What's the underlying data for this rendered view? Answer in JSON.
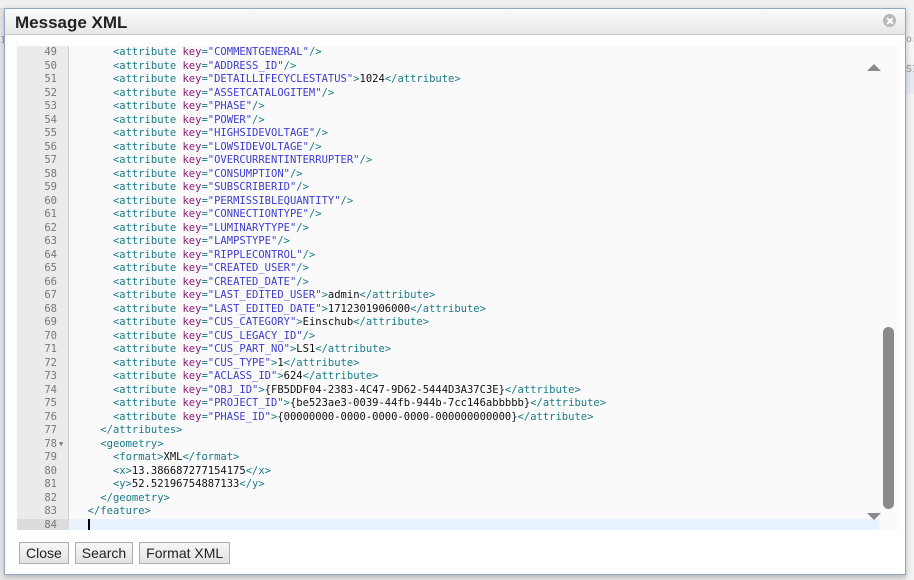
{
  "dialog": {
    "title": "Message XML",
    "close_icon": "close-circle-icon"
  },
  "background": {
    "left_fragment": "1",
    "right_fragment_1": "or",
    "right_fragment_2": "SIS"
  },
  "editor": {
    "lines": [
      {
        "n": "49",
        "indent": 6,
        "tokens": [
          [
            "tag",
            "<attribute "
          ],
          [
            "attr",
            "key"
          ],
          [
            "tag",
            "="
          ],
          [
            "str",
            "\"COMMENTGENERAL\""
          ],
          [
            "tag",
            "/>"
          ]
        ]
      },
      {
        "n": "50",
        "indent": 6,
        "tokens": [
          [
            "tag",
            "<attribute "
          ],
          [
            "attr",
            "key"
          ],
          [
            "tag",
            "="
          ],
          [
            "str",
            "\"ADDRESS_ID\""
          ],
          [
            "tag",
            "/>"
          ]
        ]
      },
      {
        "n": "51",
        "indent": 6,
        "tokens": [
          [
            "tag",
            "<attribute "
          ],
          [
            "attr",
            "key"
          ],
          [
            "tag",
            "="
          ],
          [
            "str",
            "\"DETAILLIFECYCLESTATUS\""
          ],
          [
            "tag",
            ">"
          ],
          [
            "text",
            "1024"
          ],
          [
            "tag",
            "</attribute>"
          ]
        ]
      },
      {
        "n": "52",
        "indent": 6,
        "tokens": [
          [
            "tag",
            "<attribute "
          ],
          [
            "attr",
            "key"
          ],
          [
            "tag",
            "="
          ],
          [
            "str",
            "\"ASSETCATALOGITEM\""
          ],
          [
            "tag",
            "/>"
          ]
        ]
      },
      {
        "n": "53",
        "indent": 6,
        "tokens": [
          [
            "tag",
            "<attribute "
          ],
          [
            "attr",
            "key"
          ],
          [
            "tag",
            "="
          ],
          [
            "str",
            "\"PHASE\""
          ],
          [
            "tag",
            "/>"
          ]
        ]
      },
      {
        "n": "54",
        "indent": 6,
        "tokens": [
          [
            "tag",
            "<attribute "
          ],
          [
            "attr",
            "key"
          ],
          [
            "tag",
            "="
          ],
          [
            "str",
            "\"POWER\""
          ],
          [
            "tag",
            "/>"
          ]
        ]
      },
      {
        "n": "55",
        "indent": 6,
        "tokens": [
          [
            "tag",
            "<attribute "
          ],
          [
            "attr",
            "key"
          ],
          [
            "tag",
            "="
          ],
          [
            "str",
            "\"HIGHSIDEVOLTAGE\""
          ],
          [
            "tag",
            "/>"
          ]
        ]
      },
      {
        "n": "56",
        "indent": 6,
        "tokens": [
          [
            "tag",
            "<attribute "
          ],
          [
            "attr",
            "key"
          ],
          [
            "tag",
            "="
          ],
          [
            "str",
            "\"LOWSIDEVOLTAGE\""
          ],
          [
            "tag",
            "/>"
          ]
        ]
      },
      {
        "n": "57",
        "indent": 6,
        "tokens": [
          [
            "tag",
            "<attribute "
          ],
          [
            "attr",
            "key"
          ],
          [
            "tag",
            "="
          ],
          [
            "str",
            "\"OVERCURRENTINTERRUPTER\""
          ],
          [
            "tag",
            "/>"
          ]
        ]
      },
      {
        "n": "58",
        "indent": 6,
        "tokens": [
          [
            "tag",
            "<attribute "
          ],
          [
            "attr",
            "key"
          ],
          [
            "tag",
            "="
          ],
          [
            "str",
            "\"CONSUMPTION\""
          ],
          [
            "tag",
            "/>"
          ]
        ]
      },
      {
        "n": "59",
        "indent": 6,
        "tokens": [
          [
            "tag",
            "<attribute "
          ],
          [
            "attr",
            "key"
          ],
          [
            "tag",
            "="
          ],
          [
            "str",
            "\"SUBSCRIBERID\""
          ],
          [
            "tag",
            "/>"
          ]
        ]
      },
      {
        "n": "60",
        "indent": 6,
        "tokens": [
          [
            "tag",
            "<attribute "
          ],
          [
            "attr",
            "key"
          ],
          [
            "tag",
            "="
          ],
          [
            "str",
            "\"PERMISSIBLEQUANTITY\""
          ],
          [
            "tag",
            "/>"
          ]
        ]
      },
      {
        "n": "61",
        "indent": 6,
        "tokens": [
          [
            "tag",
            "<attribute "
          ],
          [
            "attr",
            "key"
          ],
          [
            "tag",
            "="
          ],
          [
            "str",
            "\"CONNECTIONTYPE\""
          ],
          [
            "tag",
            "/>"
          ]
        ]
      },
      {
        "n": "62",
        "indent": 6,
        "tokens": [
          [
            "tag",
            "<attribute "
          ],
          [
            "attr",
            "key"
          ],
          [
            "tag",
            "="
          ],
          [
            "str",
            "\"LUMINARYTYPE\""
          ],
          [
            "tag",
            "/>"
          ]
        ]
      },
      {
        "n": "63",
        "indent": 6,
        "tokens": [
          [
            "tag",
            "<attribute "
          ],
          [
            "attr",
            "key"
          ],
          [
            "tag",
            "="
          ],
          [
            "str",
            "\"LAMPSTYPE\""
          ],
          [
            "tag",
            "/>"
          ]
        ]
      },
      {
        "n": "64",
        "indent": 6,
        "tokens": [
          [
            "tag",
            "<attribute "
          ],
          [
            "attr",
            "key"
          ],
          [
            "tag",
            "="
          ],
          [
            "str",
            "\"RIPPLECONTROL\""
          ],
          [
            "tag",
            "/>"
          ]
        ]
      },
      {
        "n": "65",
        "indent": 6,
        "tokens": [
          [
            "tag",
            "<attribute "
          ],
          [
            "attr",
            "key"
          ],
          [
            "tag",
            "="
          ],
          [
            "str",
            "\"CREATED_USER\""
          ],
          [
            "tag",
            "/>"
          ]
        ]
      },
      {
        "n": "66",
        "indent": 6,
        "tokens": [
          [
            "tag",
            "<attribute "
          ],
          [
            "attr",
            "key"
          ],
          [
            "tag",
            "="
          ],
          [
            "str",
            "\"CREATED_DATE\""
          ],
          [
            "tag",
            "/>"
          ]
        ]
      },
      {
        "n": "67",
        "indent": 6,
        "tokens": [
          [
            "tag",
            "<attribute "
          ],
          [
            "attr",
            "key"
          ],
          [
            "tag",
            "="
          ],
          [
            "str",
            "\"LAST_EDITED_USER\""
          ],
          [
            "tag",
            ">"
          ],
          [
            "text",
            "admin"
          ],
          [
            "tag",
            "</attribute>"
          ]
        ]
      },
      {
        "n": "68",
        "indent": 6,
        "tokens": [
          [
            "tag",
            "<attribute "
          ],
          [
            "attr",
            "key"
          ],
          [
            "tag",
            "="
          ],
          [
            "str",
            "\"LAST_EDITED_DATE\""
          ],
          [
            "tag",
            ">"
          ],
          [
            "text",
            "1712301906000"
          ],
          [
            "tag",
            "</attribute>"
          ]
        ]
      },
      {
        "n": "69",
        "indent": 6,
        "tokens": [
          [
            "tag",
            "<attribute "
          ],
          [
            "attr",
            "key"
          ],
          [
            "tag",
            "="
          ],
          [
            "str",
            "\"CUS_CATEGORY\""
          ],
          [
            "tag",
            ">"
          ],
          [
            "text",
            "Einschub"
          ],
          [
            "tag",
            "</attribute>"
          ]
        ]
      },
      {
        "n": "70",
        "indent": 6,
        "tokens": [
          [
            "tag",
            "<attribute "
          ],
          [
            "attr",
            "key"
          ],
          [
            "tag",
            "="
          ],
          [
            "str",
            "\"CUS_LEGACY_ID\""
          ],
          [
            "tag",
            "/>"
          ]
        ]
      },
      {
        "n": "71",
        "indent": 6,
        "tokens": [
          [
            "tag",
            "<attribute "
          ],
          [
            "attr",
            "key"
          ],
          [
            "tag",
            "="
          ],
          [
            "str",
            "\"CUS_PART_NO\""
          ],
          [
            "tag",
            ">"
          ],
          [
            "text",
            "LS1"
          ],
          [
            "tag",
            "</attribute>"
          ]
        ]
      },
      {
        "n": "72",
        "indent": 6,
        "tokens": [
          [
            "tag",
            "<attribute "
          ],
          [
            "attr",
            "key"
          ],
          [
            "tag",
            "="
          ],
          [
            "str",
            "\"CUS_TYPE\""
          ],
          [
            "tag",
            ">"
          ],
          [
            "text",
            "1"
          ],
          [
            "tag",
            "</attribute>"
          ]
        ]
      },
      {
        "n": "73",
        "indent": 6,
        "tokens": [
          [
            "tag",
            "<attribute "
          ],
          [
            "attr",
            "key"
          ],
          [
            "tag",
            "="
          ],
          [
            "str",
            "\"ACLASS_ID\""
          ],
          [
            "tag",
            ">"
          ],
          [
            "text",
            "624"
          ],
          [
            "tag",
            "</attribute>"
          ]
        ]
      },
      {
        "n": "74",
        "indent": 6,
        "tokens": [
          [
            "tag",
            "<attribute "
          ],
          [
            "attr",
            "key"
          ],
          [
            "tag",
            "="
          ],
          [
            "str",
            "\"OBJ_ID\""
          ],
          [
            "tag",
            ">"
          ],
          [
            "text",
            "{FB5DDF04-2383-4C47-9D62-5444D3A37C3E}"
          ],
          [
            "tag",
            "</attribute>"
          ]
        ]
      },
      {
        "n": "75",
        "indent": 6,
        "tokens": [
          [
            "tag",
            "<attribute "
          ],
          [
            "attr",
            "key"
          ],
          [
            "tag",
            "="
          ],
          [
            "str",
            "\"PROJECT_ID\""
          ],
          [
            "tag",
            ">"
          ],
          [
            "text",
            "{be523ae3-0039-44fb-944b-7cc146abbbbb}"
          ],
          [
            "tag",
            "</attribute>"
          ]
        ]
      },
      {
        "n": "76",
        "indent": 6,
        "tokens": [
          [
            "tag",
            "<attribute "
          ],
          [
            "attr",
            "key"
          ],
          [
            "tag",
            "="
          ],
          [
            "str",
            "\"PHASE_ID\""
          ],
          [
            "tag",
            ">"
          ],
          [
            "text",
            "{00000000-0000-0000-0000-000000000000}"
          ],
          [
            "tag",
            "</attribute>"
          ]
        ]
      },
      {
        "n": "77",
        "indent": 4,
        "tokens": [
          [
            "tag",
            "</attributes>"
          ]
        ]
      },
      {
        "n": "78",
        "indent": 4,
        "fold": true,
        "tokens": [
          [
            "tag",
            "<geometry>"
          ]
        ]
      },
      {
        "n": "79",
        "indent": 6,
        "tokens": [
          [
            "tag",
            "<format>"
          ],
          [
            "text",
            "XML"
          ],
          [
            "tag",
            "</format>"
          ]
        ]
      },
      {
        "n": "80",
        "indent": 6,
        "tokens": [
          [
            "tag",
            "<x>"
          ],
          [
            "text",
            "13.386687277154175"
          ],
          [
            "tag",
            "</x>"
          ]
        ]
      },
      {
        "n": "81",
        "indent": 6,
        "tokens": [
          [
            "tag",
            "<y>"
          ],
          [
            "text",
            "52.52196754887133"
          ],
          [
            "tag",
            "</y>"
          ]
        ]
      },
      {
        "n": "82",
        "indent": 4,
        "tokens": [
          [
            "tag",
            "</geometry>"
          ]
        ]
      },
      {
        "n": "83",
        "indent": 2,
        "tokens": [
          [
            "tag",
            "</feature>"
          ]
        ]
      },
      {
        "n": "84",
        "indent": 2,
        "active": true,
        "cursor": true,
        "tokens": []
      }
    ],
    "fold_icon": "fold-arrow-icon"
  },
  "footer": {
    "close_label": "Close",
    "search_label": "Search",
    "format_label": "Format XML"
  },
  "colors": {
    "tag": "#1a7b8a",
    "attr": "#8a1a7a",
    "string": "#3c3cd0",
    "text": "#111111",
    "active_line": "#e8f2fe"
  }
}
